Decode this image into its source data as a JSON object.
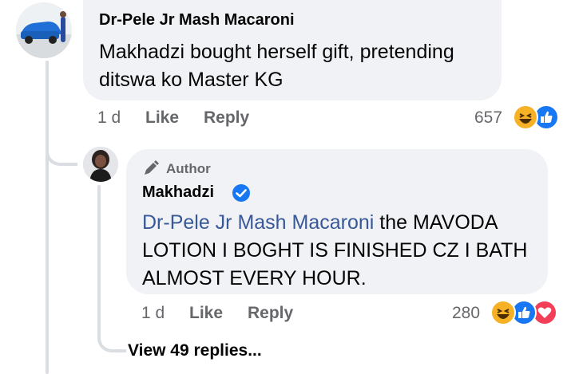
{
  "comment": {
    "author": "Dr-Pele Jr Mash Macaroni",
    "text_line1": "Makhadzi bought herself gift, pretending",
    "text_line2": "ditswa ko Master KG",
    "time": "1 d",
    "like_label": "Like",
    "reply_label": "Reply",
    "reaction_count": "657",
    "reactions": [
      "haha-icon",
      "like-icon"
    ]
  },
  "reply": {
    "badge_label": "Author",
    "author": "Makhadzi",
    "verified": true,
    "mention": "Dr-Pele Jr Mash Macaroni",
    "text_line1": " the MAVODA",
    "text_line2": "LOTION I BOGHT IS FINISHED CZ I BATH",
    "text_line3": "ALMOST EVERY HOUR.",
    "time": "1 d",
    "like_label": "Like",
    "reply_label": "Reply",
    "reaction_count": "280",
    "reactions": [
      "haha-icon",
      "like-icon",
      "love-icon"
    ]
  },
  "view_replies": "View 49 replies...",
  "colors": {
    "bubble": "#f0f2f5",
    "secondary_text": "#65676b",
    "link": "#385898",
    "like_blue": "#1877f2",
    "love_red": "#f33e58",
    "haha_yellow": "#f7b125"
  }
}
